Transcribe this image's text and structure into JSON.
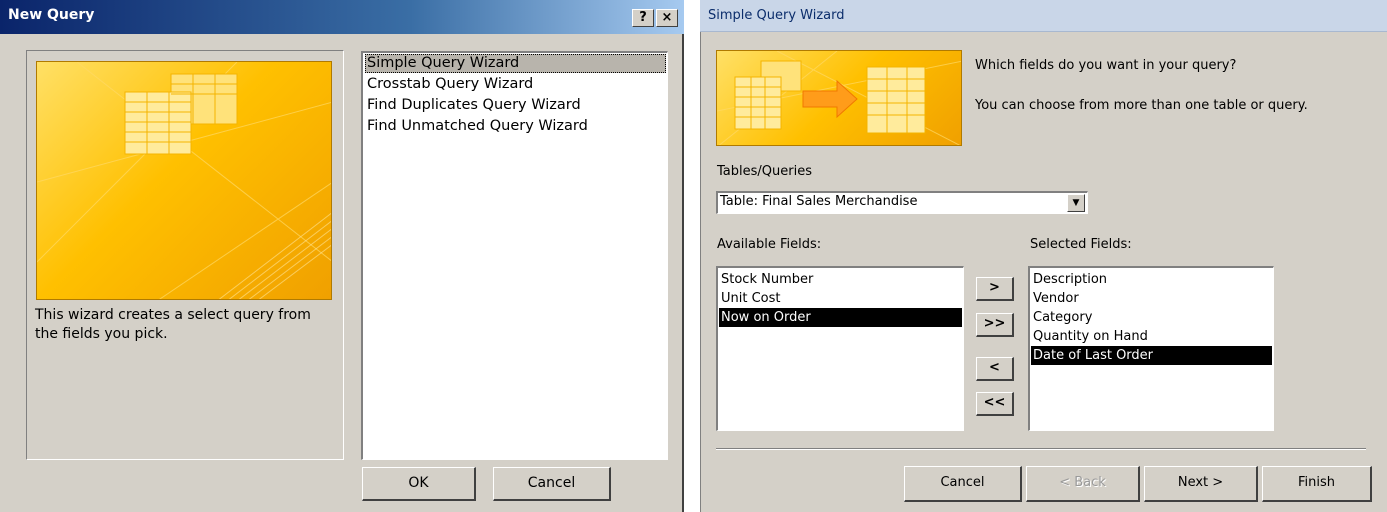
{
  "colors": {
    "title_bar": "#0a246a",
    "window_face": "#d4d0c8",
    "selection_black": "#000000",
    "picture_gold": "#ffc000"
  },
  "new_query": {
    "title": "New Query",
    "help_button": "?",
    "close_button": "×",
    "description": "This wizard creates a select query from the fields you pick.",
    "wizards": [
      {
        "label": "Simple Query Wizard",
        "selected": true
      },
      {
        "label": "Crosstab Query Wizard",
        "selected": false
      },
      {
        "label": "Find Duplicates Query Wizard",
        "selected": false
      },
      {
        "label": "Find Unmatched Query Wizard",
        "selected": false
      }
    ],
    "ok_label": "OK",
    "cancel_label": "Cancel"
  },
  "simple_wizard": {
    "title": "Simple Query Wizard",
    "question": "Which fields do you want in your query?",
    "hint": "You can choose from more than one table or query.",
    "tables_queries_label": "Tables/Queries",
    "tables_queries_value": "Table: Final Sales Merchandise",
    "available_label": "Available Fields:",
    "selected_label": "Selected Fields:",
    "available_fields": [
      {
        "label": "Stock Number",
        "selected": false
      },
      {
        "label": "Unit Cost",
        "selected": false
      },
      {
        "label": "Now on Order",
        "selected": true
      }
    ],
    "selected_fields": [
      {
        "label": "Description",
        "selected": false
      },
      {
        "label": "Vendor",
        "selected": false
      },
      {
        "label": "Category",
        "selected": false
      },
      {
        "label": "Quantity on Hand",
        "selected": false
      },
      {
        "label": "Date of Last Order",
        "selected": true
      }
    ],
    "move_buttons": {
      "add_one": ">",
      "add_all": ">>",
      "remove_one": "<",
      "remove_all": "<<"
    },
    "buttons": {
      "cancel": "Cancel",
      "back": "< Back",
      "next": "Next >",
      "finish": "Finish"
    }
  }
}
